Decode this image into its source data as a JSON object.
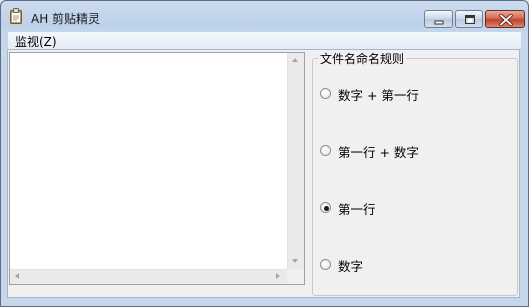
{
  "window": {
    "title": "AH 剪贴精灵"
  },
  "menu": {
    "items": [
      {
        "label": "监视(Z)"
      }
    ]
  },
  "clipboard_text": {
    "value": ""
  },
  "naming_rule": {
    "legend": "文件名命名规则",
    "options": [
      {
        "label": "数字 + 第一行",
        "selected": false
      },
      {
        "label": "第一行 + 数字",
        "selected": false
      },
      {
        "label": "第一行",
        "selected": true
      },
      {
        "label": "数字",
        "selected": false
      }
    ]
  },
  "icons": {
    "app": "clipboard-icon",
    "minimize": "minimize-icon",
    "maximize": "maximize-icon",
    "close": "close-icon"
  },
  "colors": {
    "title_bar": "#c6d7ec",
    "close_button": "#c0422c",
    "client_background": "#f0f0f0"
  }
}
